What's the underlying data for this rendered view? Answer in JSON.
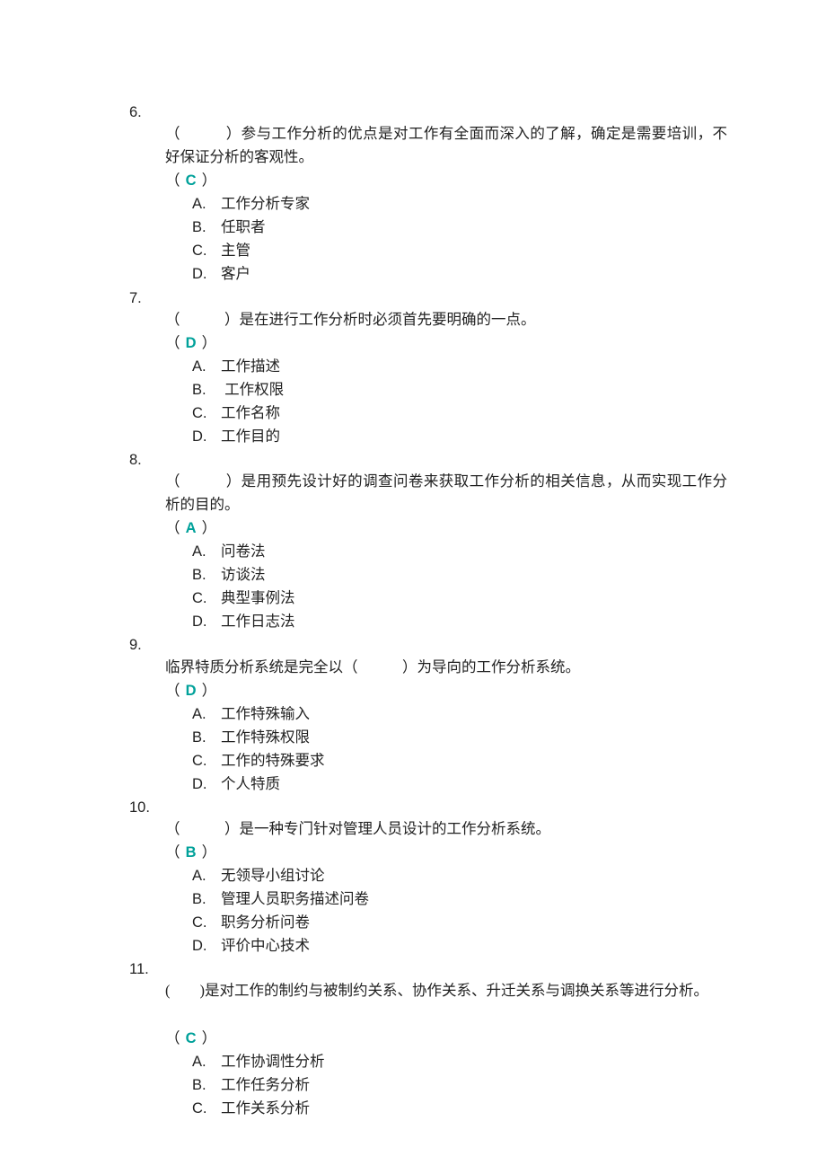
{
  "questions": [
    {
      "num": "6.",
      "stem": "（　　　）参与工作分析的优点是对工作有全面而深入的了解，确定是需要培训，不好保证分析的客观性。",
      "answer": "C",
      "options": [
        {
          "letter": "A.",
          "text": "工作分析专家"
        },
        {
          "letter": "B.",
          "text": "任职者"
        },
        {
          "letter": "C.",
          "text": "主管"
        },
        {
          "letter": "D.",
          "text": "客户"
        }
      ]
    },
    {
      "num": "7.",
      "stem": "（　　　）是在进行工作分析时必须首先要明确的一点。",
      "answer": "D",
      "options": [
        {
          "letter": "A.",
          "text": "工作描述"
        },
        {
          "letter": "B.",
          "text": " 工作权限"
        },
        {
          "letter": "C.",
          "text": "工作名称"
        },
        {
          "letter": "D.",
          "text": "工作目的"
        }
      ]
    },
    {
      "num": "8.",
      "stem": "（　　　）是用预先设计好的调查问卷来获取工作分析的相关信息，从而实现工作分析的目的。",
      "answer": "A",
      "options": [
        {
          "letter": "A.",
          "text": "问卷法"
        },
        {
          "letter": "B.",
          "text": "访谈法"
        },
        {
          "letter": "C.",
          "text": "典型事例法"
        },
        {
          "letter": "D.",
          "text": "工作日志法"
        }
      ]
    },
    {
      "num": "9.",
      "stem": "临界特质分析系统是完全以（　　　）为导向的工作分析系统。",
      "answer": "D",
      "options": [
        {
          "letter": "A.",
          "text": "工作特殊输入"
        },
        {
          "letter": "B.",
          "text": "工作特殊权限"
        },
        {
          "letter": "C.",
          "text": "工作的特殊要求"
        },
        {
          "letter": "D.",
          "text": "个人特质"
        }
      ]
    },
    {
      "num": "10.",
      "stem": "（　　　）是一种专门针对管理人员设计的工作分析系统。",
      "answer": "B",
      "options": [
        {
          "letter": "A.",
          "text": "无领导小组讨论"
        },
        {
          "letter": "B.",
          "text": "管理人员职务描述问卷"
        },
        {
          "letter": "C.",
          "text": "职务分析问卷"
        },
        {
          "letter": "D.",
          "text": "评价中心技术"
        }
      ]
    },
    {
      "num": "11.",
      "stem": "(　　)是对工作的制约与被制约关系、协作关系、升迁关系与调换关系等进行分析。",
      "stem_break_after": true,
      "answer": "C",
      "options": [
        {
          "letter": "A.",
          "text": "工作协调性分析"
        },
        {
          "letter": "B.",
          "text": "工作任务分析"
        },
        {
          "letter": "C.",
          "text": "工作关系分析"
        }
      ]
    }
  ]
}
